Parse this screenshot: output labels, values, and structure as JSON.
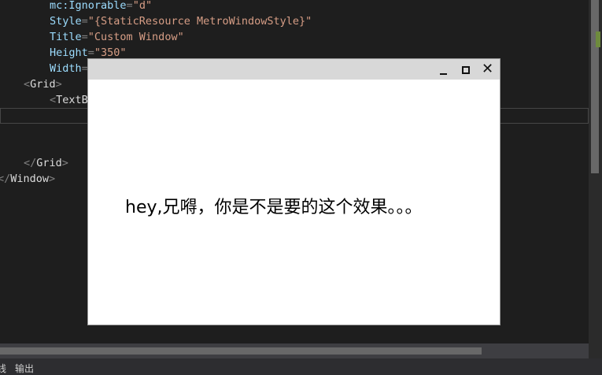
{
  "editor": {
    "lines": [
      {
        "attr": "mc:Ignorable",
        "value": "\"d\""
      },
      {
        "attr": "Style",
        "value": "\"{StaticResource MetroWindowStyle}\""
      },
      {
        "attr": "Title",
        "value": "\"Custom Window\""
      },
      {
        "attr": "Height",
        "value": "\"350\""
      },
      {
        "attr": "Width",
        "value": ""
      }
    ],
    "grid_open": "Grid",
    "textblock_open": "TextB",
    "grid_close": "Grid",
    "window_close": "Window"
  },
  "bottom_tabs": [
    "线",
    "输出"
  ],
  "window": {
    "minimize_glyph": "minimize-icon",
    "maximize_glyph": "maximize-icon",
    "close_label": "✕",
    "content_text": "hey,兄嘚，你是不是要的这个效果。。。"
  }
}
